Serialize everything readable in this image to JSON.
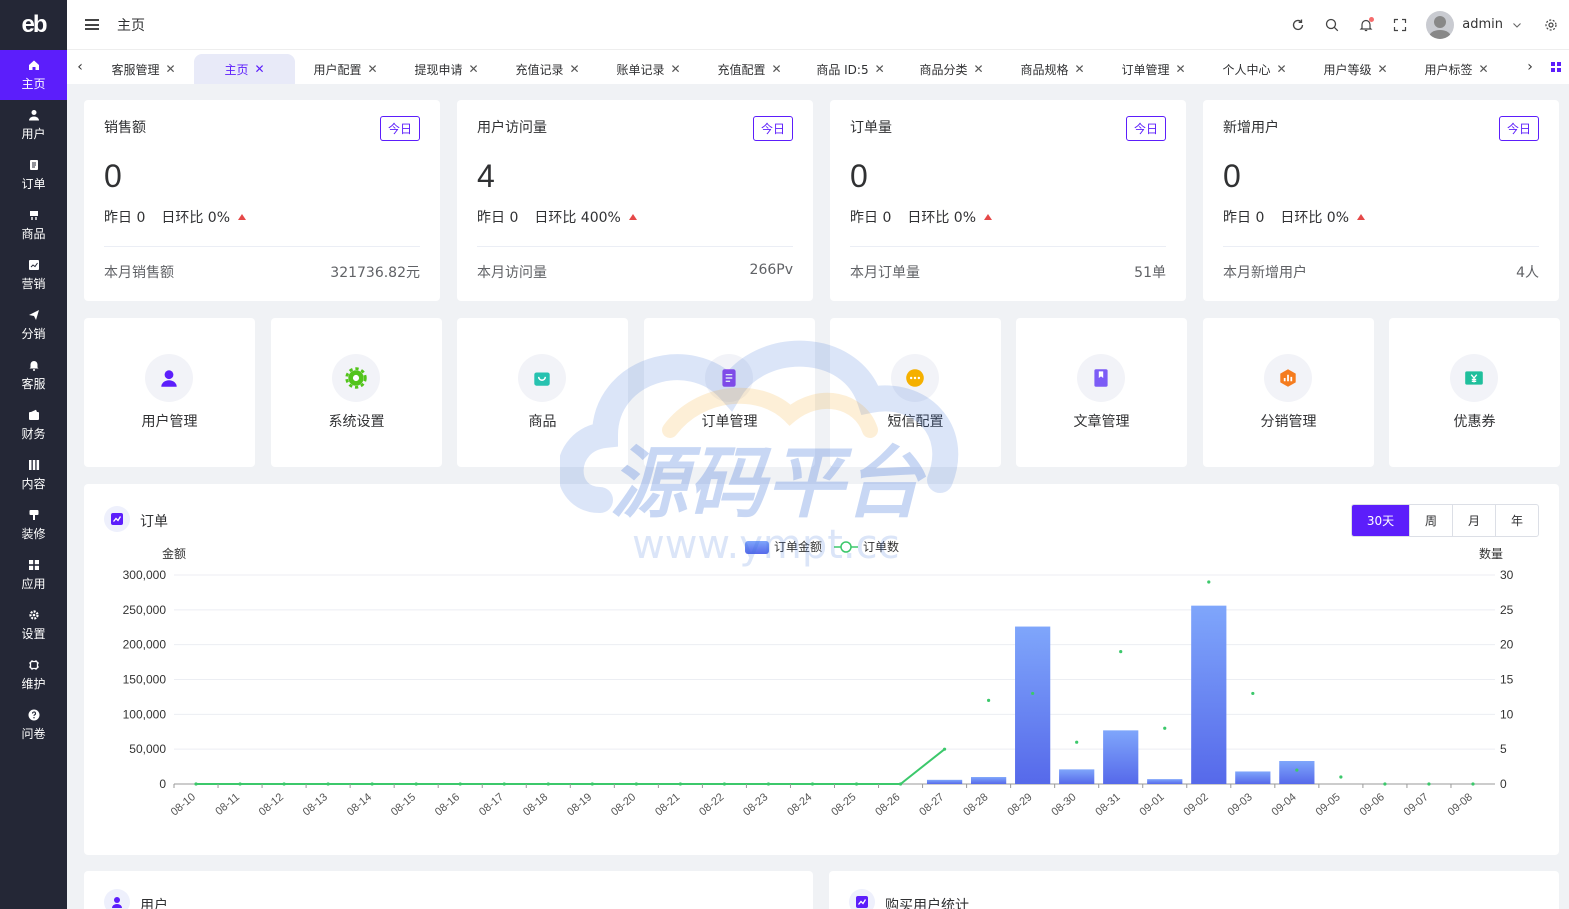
{
  "logo": "eb",
  "sidebar": {
    "items": [
      {
        "label": "主页",
        "icon": "home-icon",
        "active": true
      },
      {
        "label": "用户",
        "icon": "user-icon"
      },
      {
        "label": "订单",
        "icon": "order-icon"
      },
      {
        "label": "商品",
        "icon": "goods-icon"
      },
      {
        "label": "营销",
        "icon": "marketing-icon"
      },
      {
        "label": "分销",
        "icon": "send-icon"
      },
      {
        "label": "客服",
        "icon": "bell-icon"
      },
      {
        "label": "财务",
        "icon": "finance-icon"
      },
      {
        "label": "内容",
        "icon": "content-icon"
      },
      {
        "label": "装修",
        "icon": "brush-icon"
      },
      {
        "label": "应用",
        "icon": "apps-icon"
      },
      {
        "label": "设置",
        "icon": "gear-icon"
      },
      {
        "label": "维护",
        "icon": "chip-icon"
      },
      {
        "label": "问卷",
        "icon": "question-icon"
      }
    ]
  },
  "header": {
    "breadcrumb": "主页",
    "username": "admin"
  },
  "tabs": [
    {
      "label": "客服管理"
    },
    {
      "label": "主页",
      "active": true
    },
    {
      "label": "用户配置"
    },
    {
      "label": "提现申请"
    },
    {
      "label": "充值记录"
    },
    {
      "label": "账单记录"
    },
    {
      "label": "充值配置"
    },
    {
      "label": "商品 ID:5"
    },
    {
      "label": "商品分类"
    },
    {
      "label": "商品规格"
    },
    {
      "label": "订单管理"
    },
    {
      "label": "个人中心"
    },
    {
      "label": "用户等级"
    },
    {
      "label": "用户标签"
    },
    {
      "label": "用"
    }
  ],
  "stats": [
    {
      "title": "销售额",
      "badge": "今日",
      "value": "0",
      "yesterday": "昨日 0",
      "ratio": "日环比 0%",
      "foot_label": "本月销售额",
      "foot_value": "321736.82元"
    },
    {
      "title": "用户访问量",
      "badge": "今日",
      "value": "4",
      "yesterday": "昨日 0",
      "ratio": "日环比 400%",
      "foot_label": "本月访问量",
      "foot_value": "266Pv"
    },
    {
      "title": "订单量",
      "badge": "今日",
      "value": "0",
      "yesterday": "昨日 0",
      "ratio": "日环比 0%",
      "foot_label": "本月订单量",
      "foot_value": "51单"
    },
    {
      "title": "新增用户",
      "badge": "今日",
      "value": "0",
      "yesterday": "昨日 0",
      "ratio": "日环比 0%",
      "foot_label": "本月新增用户",
      "foot_value": "4人"
    }
  ],
  "quick_links": [
    {
      "label": "用户管理",
      "color": "#5c1efb",
      "icon": "user-manage-icon"
    },
    {
      "label": "系统设置",
      "color": "#52c41a",
      "icon": "settings-icon"
    },
    {
      "label": "商品",
      "color": "#27c2b0",
      "icon": "shop-bag-icon"
    },
    {
      "label": "订单管理",
      "color": "#8e44ec",
      "icon": "order-list-icon"
    },
    {
      "label": "短信配置",
      "color": "#f5b000",
      "icon": "sms-icon"
    },
    {
      "label": "文章管理",
      "color": "#7c5cf6",
      "icon": "article-icon"
    },
    {
      "label": "分销管理",
      "color": "#f57c1f",
      "icon": "distribution-icon"
    },
    {
      "label": "优惠券",
      "color": "#1fbf9c",
      "icon": "coupon-icon"
    }
  ],
  "order_section": {
    "title": "订单",
    "periods": [
      "30天",
      "周",
      "月",
      "年"
    ],
    "active_period": "30天"
  },
  "bottom": {
    "left_title": "用户",
    "right_title": "购买用户统计"
  },
  "watermark": {
    "line1": "源码平台",
    "line2": "www.ympt.cc"
  },
  "colors": {
    "accent": "#5c1efb",
    "sidebar": "#242736",
    "bar": "#5b7cf4",
    "line": "#3cc86b"
  },
  "chart_data": {
    "type": "bar",
    "left_axis_title": "金额",
    "right_axis_title": "数量",
    "legend": [
      "订单金额",
      "订单数"
    ],
    "legend_placement": "top-center",
    "ylim_left": [
      0,
      300000
    ],
    "ylim_right": [
      0,
      30
    ],
    "yticks_left": [
      "0",
      "50,000",
      "100,000",
      "150,000",
      "200,000",
      "250,000",
      "300,000"
    ],
    "yticks_right": [
      "0",
      "5",
      "10",
      "15",
      "20",
      "25",
      "30"
    ],
    "categories": [
      "08-10",
      "08-11",
      "08-12",
      "08-13",
      "08-14",
      "08-15",
      "08-16",
      "08-17",
      "08-18",
      "08-19",
      "08-20",
      "08-21",
      "08-22",
      "08-23",
      "08-24",
      "08-25",
      "08-26",
      "08-27",
      "08-28",
      "08-29",
      "08-30",
      "08-31",
      "09-01",
      "09-02",
      "09-03",
      "09-04",
      "09-05",
      "09-06",
      "09-07",
      "09-08"
    ],
    "series": [
      {
        "name": "订单金额",
        "type": "bar",
        "values": [
          0,
          0,
          0,
          0,
          0,
          0,
          0,
          0,
          0,
          0,
          0,
          0,
          0,
          0,
          0,
          0,
          0,
          6000,
          10000,
          226000,
          21000,
          77000,
          7000,
          256000,
          18000,
          33000,
          0,
          0,
          0,
          0
        ]
      },
      {
        "name": "订单数",
        "type": "line",
        "values": [
          0,
          0,
          0,
          0,
          0,
          0,
          0,
          0,
          0,
          0,
          0,
          0,
          0,
          0,
          0,
          0,
          0,
          5,
          12,
          13,
          6,
          19,
          8,
          29,
          13,
          2,
          1,
          0,
          0,
          0
        ]
      }
    ]
  }
}
